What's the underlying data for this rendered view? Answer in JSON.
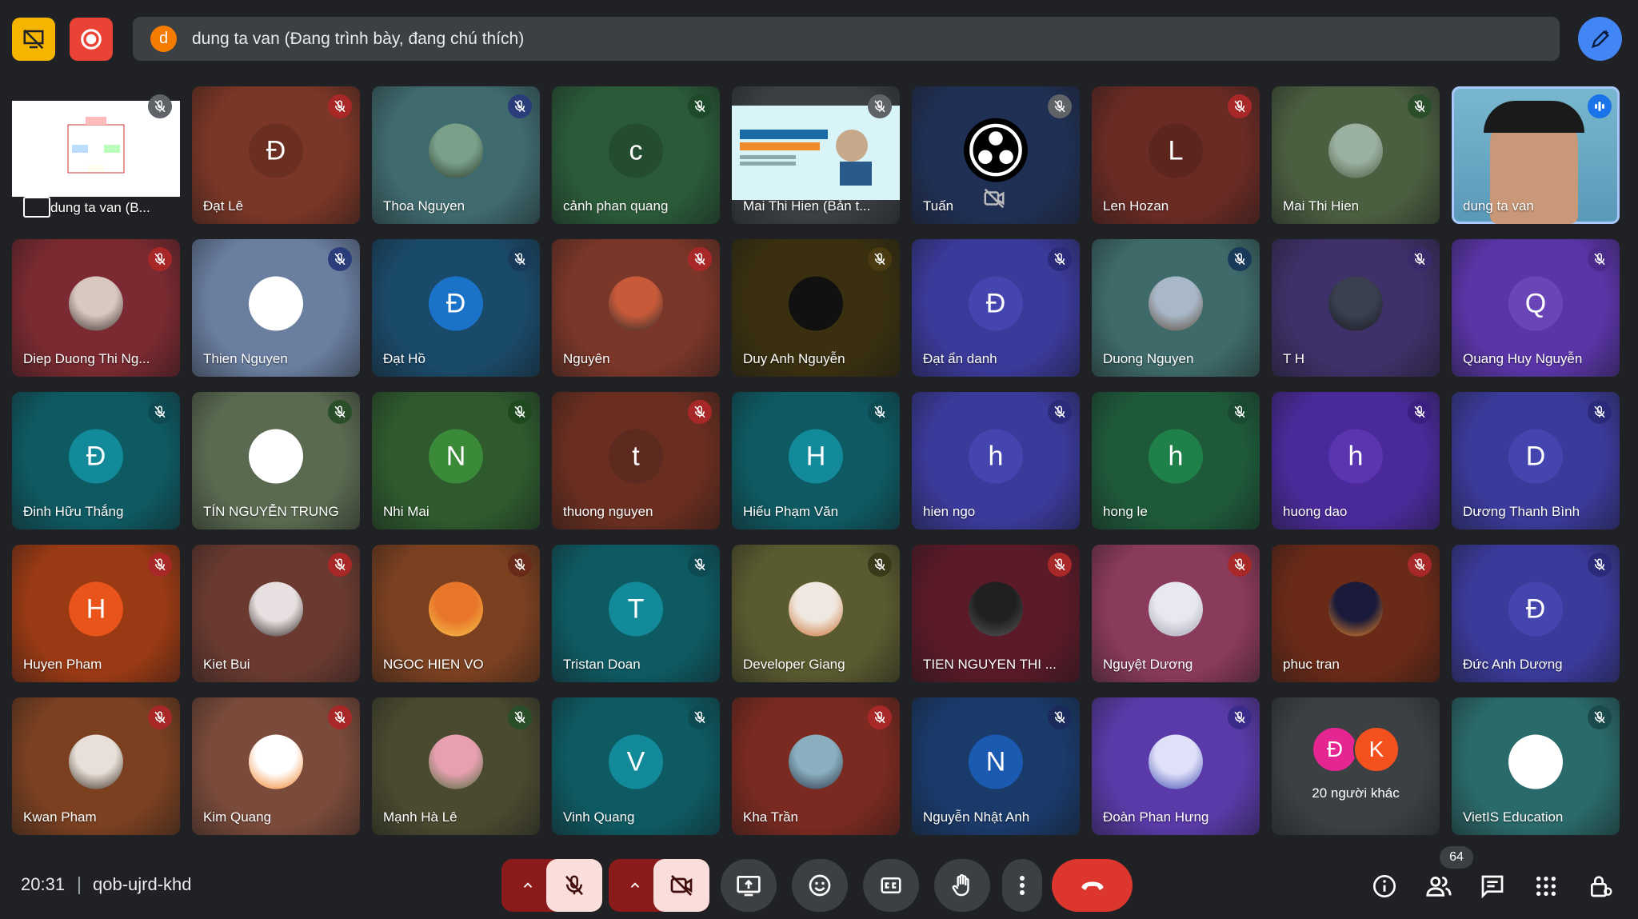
{
  "top": {
    "present_off_icon": "presentation-off-icon",
    "record_icon": "record-icon",
    "banner_avatar_letter": "d",
    "banner_text": "dung ta van (Đang trình bày, đang chú thích)",
    "annotate_icon": "pen-icon"
  },
  "tiles": [
    {
      "name": "dung ta van (B...",
      "kind": "share"
    },
    {
      "name": "Đạt Lê",
      "letter": "Đ",
      "bg": "#7a3626",
      "av": "#6b2f22",
      "mic": "#a82828"
    },
    {
      "name": "Thoa Nguyen",
      "photo": "person-landscape",
      "bg": "#3f6a6e",
      "mic": "#2a3d7a"
    },
    {
      "name": "cảnh phan quang",
      "letter": "c",
      "bg": "#2a5a38",
      "av": "#244d30",
      "mic": "#1f4a2a"
    },
    {
      "name": "Mai Thi Hien (Bản t...",
      "kind": "slide",
      "bg": "#3c4043"
    },
    {
      "name": "Tuấn",
      "kind": "obs",
      "bg": "#203055"
    },
    {
      "name": "Len Hozan",
      "letter": "L",
      "bg": "#6a2b24",
      "av": "#5c261f",
      "mic": "#a82828"
    },
    {
      "name": "Mai Thi Hien",
      "photo": "person-outdoor",
      "bg": "#4a5e40",
      "mic": "#2a4d2a"
    },
    {
      "name": "dung ta van",
      "kind": "cam"
    },
    {
      "name": "Diep Duong Thi Ng...",
      "photo": "person-girl",
      "bg": "#7a2a30",
      "mic": "#a82828"
    },
    {
      "name": "Thien Nguyen",
      "photo": "script-logo",
      "bg": "#6a7ea0",
      "mic": "#2a3d7a"
    },
    {
      "name": "Đạt Hồ",
      "letter": "Đ",
      "bg": "#1a4a6a",
      "av": "#1a73c8",
      "mic": "#1a3a5a"
    },
    {
      "name": "Nguyên",
      "photo": "person-crowd",
      "bg": "#7a3628",
      "mic": "#a82828"
    },
    {
      "name": "Duy Anh Nguyễn",
      "photo": "gamepad",
      "bg": "#3a3010",
      "mic": "#4a3a10"
    },
    {
      "name": "Đạt ẩn danh",
      "letter": "Đ",
      "bg": "#3a3a9a",
      "av": "#4545b0",
      "mic": "#2a2a7a"
    },
    {
      "name": "Duong Nguyen",
      "photo": "person-man",
      "bg": "#3e6a6a",
      "mic": "#1a3a5a"
    },
    {
      "name": "T H",
      "photo": "dark-figure",
      "bg": "#3e3068",
      "mic": "#3a2a6a"
    },
    {
      "name": "Quang Huy Nguyễn",
      "letter": "Q",
      "bg": "#5a35a8",
      "av": "#6a45b8",
      "mic": "#4a2a8a"
    },
    {
      "name": "Đinh Hữu Thắng",
      "letter": "Đ",
      "bg": "#0e5a62",
      "av": "#128a9a",
      "mic": "#0e4a52"
    },
    {
      "name": "TÍN NGUYỄN TRUNG",
      "photo": "atom",
      "bg": "#5a6a50",
      "mic": "#2a4d2a"
    },
    {
      "name": "Nhi Mai",
      "letter": "N",
      "bg": "#2e5a2e",
      "av": "#3a8a3a",
      "mic": "#1f4a1f"
    },
    {
      "name": "thuong nguyen",
      "letter": "t",
      "bg": "#6a2e20",
      "av": "#5c2a1e",
      "mic": "#a82828"
    },
    {
      "name": "Hiếu Phạm Văn",
      "letter": "H",
      "bg": "#0e5a62",
      "av": "#128a9a",
      "mic": "#0e4a52"
    },
    {
      "name": "hien ngo",
      "letter": "h",
      "bg": "#3a3a9a",
      "av": "#4545b0",
      "mic": "#2a2a7a"
    },
    {
      "name": "hong le",
      "letter": "h",
      "bg": "#1e5a3a",
      "av": "#20804a",
      "mic": "#1a4a30"
    },
    {
      "name": "huong dao",
      "letter": "h",
      "bg": "#4a2a9a",
      "av": "#5a35b0",
      "mic": "#3a1f80"
    },
    {
      "name": "Dương Thanh Bình",
      "letter": "D",
      "bg": "#3a3a9a",
      "av": "#4545b0",
      "mic": "#2a2a7a"
    },
    {
      "name": "Huyen Pham",
      "letter": "H",
      "bg": "#9a3a14",
      "av": "#e8541a",
      "mic": "#a82828"
    },
    {
      "name": "Kiet Bui",
      "photo": "person-girl2",
      "bg": "#6a3a30",
      "mic": "#a82828"
    },
    {
      "name": "NGOC HIEN VO",
      "photo": "candles",
      "bg": "#7a4020",
      "mic": "#6a2a1a"
    },
    {
      "name": "Tristan Doan",
      "letter": "T",
      "bg": "#0e5a62",
      "av": "#128a9a",
      "mic": "#0e4a52"
    },
    {
      "name": "Developer Giang",
      "photo": "anime",
      "bg": "#5a5a30",
      "mic": "#3a3a1a"
    },
    {
      "name": "TIEN NGUYEN THI ...",
      "photo": "couple",
      "bg": "#5a1a28",
      "mic": "#a82828"
    },
    {
      "name": "Nguyệt Dương",
      "photo": "anime-girl",
      "bg": "#8a3a5a",
      "mic": "#a82828"
    },
    {
      "name": "phuc tran",
      "photo": "fire",
      "bg": "#6a2a18",
      "mic": "#a82828"
    },
    {
      "name": "Đức Anh Dương",
      "letter": "Đ",
      "bg": "#3a3a9a",
      "av": "#4545b0",
      "mic": "#2a2a7a"
    },
    {
      "name": "Kwan Pham",
      "photo": "person-man2",
      "bg": "#7a4020",
      "mic": "#a82828"
    },
    {
      "name": "Kim Quang",
      "photo": "carrots",
      "bg": "#7a4a3a",
      "mic": "#a82828"
    },
    {
      "name": "Mạnh Hà Lê",
      "photo": "person-tree",
      "bg": "#4a4a30",
      "mic": "#2a4d2a"
    },
    {
      "name": "Vinh Quang",
      "letter": "V",
      "bg": "#0e5a62",
      "av": "#128a9a",
      "mic": "#0e4a52"
    },
    {
      "name": "Kha Trần",
      "photo": "person-man3",
      "bg": "#7a2a20",
      "mic": "#a82828"
    },
    {
      "name": "Nguyễn Nhật Anh",
      "letter": "N",
      "bg": "#1a3a6a",
      "av": "#1a5ab0",
      "mic": "#1a2a5a"
    },
    {
      "name": "Đoàn Phan Hưng",
      "photo": "logo-purple",
      "bg": "#5a3aa8",
      "mic": "#3a2a8a"
    },
    {
      "name": "20 người khác",
      "kind": "more",
      "bg": "#3c4043",
      "letters": [
        "Đ",
        "K"
      ],
      "colors": [
        "#e52592",
        "#f4511e"
      ]
    },
    {
      "name": "VietIS Education",
      "photo": "vietis",
      "bg": "#2a6a6a",
      "mic": "#1a4a4a"
    }
  ],
  "bottom": {
    "clock": "20:31",
    "meeting_code": "qob-ujrd-khd",
    "people_count": "64",
    "icons": [
      "chevron-up-icon",
      "mic-off-icon",
      "chevron-up-icon",
      "camera-off-icon",
      "present-icon",
      "emoji-icon",
      "captions-icon",
      "raise-hand-icon",
      "more-vert-icon",
      "hang-up-icon",
      "info-icon",
      "people-icon",
      "chat-icon",
      "apps-icon",
      "host-controls-icon"
    ]
  }
}
